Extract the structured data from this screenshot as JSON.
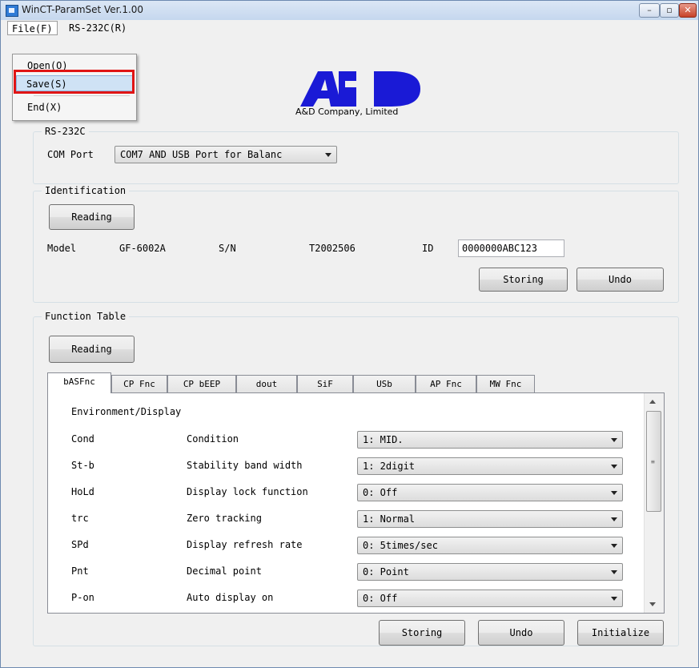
{
  "window": {
    "title": "WinCT-ParamSet Ver.1.00",
    "min": "–",
    "max": "▫",
    "close": "✕"
  },
  "menubar": {
    "file": "File(F)",
    "rs232c": "RS-232C(R)"
  },
  "file_menu": {
    "open": "Open(O)",
    "save": "Save(S)",
    "end": "End(X)"
  },
  "logo": {
    "company": "A&D Company, Limited"
  },
  "rs232c": {
    "title": "RS-232C",
    "com_port_label": "COM Port",
    "com_port_value": "COM7  AND USB Port for Balanc"
  },
  "identification": {
    "title": "Identification",
    "reading": "Reading",
    "model_label": "Model",
    "model_value": "GF-6002A",
    "sn_label": "S/N",
    "sn_value": "T2002506",
    "id_label": "ID",
    "id_value": "0000000ABC123",
    "storing": "Storing",
    "undo": "Undo"
  },
  "function_table": {
    "title": "Function Table",
    "reading": "Reading",
    "tabs": [
      "bASFnc",
      "CP Fnc",
      "CP bEEP",
      "dout",
      "SiF",
      "USb",
      "AP Fnc",
      "MW Fnc"
    ],
    "section": "Environment/Display",
    "rows": [
      {
        "code": "Cond",
        "name": "Condition",
        "value": "1: MID."
      },
      {
        "code": "St-b",
        "name": "Stability band width",
        "value": "1: 2digit"
      },
      {
        "code": "HoLd",
        "name": "Display lock function",
        "value": "0: Off"
      },
      {
        "code": "trc",
        "name": "Zero tracking",
        "value": "1: Normal"
      },
      {
        "code": "SPd",
        "name": "Display refresh rate",
        "value": "0: 5times/sec"
      },
      {
        "code": "Pnt",
        "name": "Decimal point",
        "value": "0: Point"
      },
      {
        "code": "P-on",
        "name": "Auto display on",
        "value": "0: Off"
      }
    ],
    "storing": "Storing",
    "undo": "Undo",
    "initialize": "Initialize"
  },
  "colors": {
    "highlight": "#e01515",
    "logo_blue": "#1a1ad6"
  }
}
